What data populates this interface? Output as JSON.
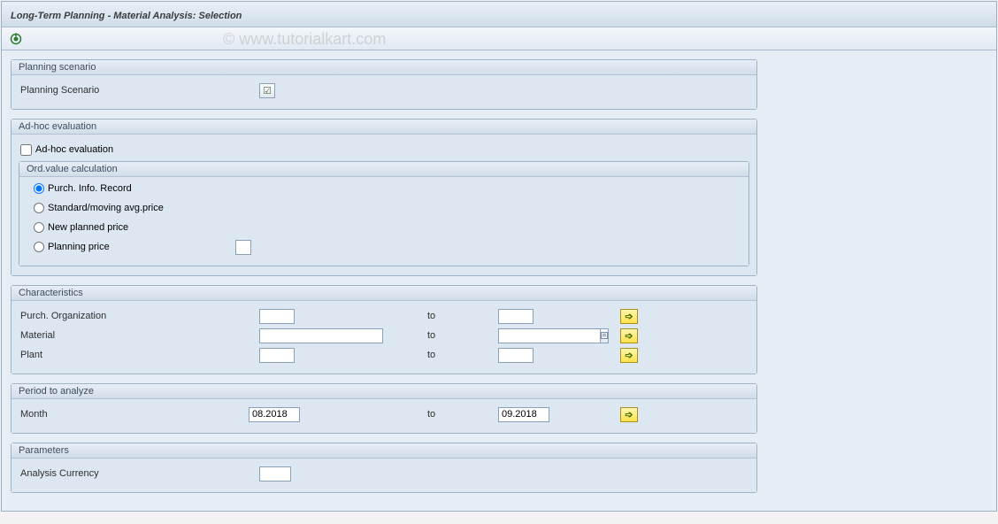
{
  "window": {
    "title": "Long-Term Planning - Material Analysis: Selection"
  },
  "watermark": "© www.tutorialkart.com",
  "icons": {
    "execute": "execute-icon",
    "arrow": "➩",
    "valuehelp": "☑"
  },
  "groups": {
    "planning_scenario": {
      "title": "Planning scenario",
      "field_label": "Planning Scenario",
      "value": ""
    },
    "adhoc": {
      "title": "Ad-hoc evaluation",
      "checkbox_label": "Ad-hoc evaluation",
      "checked": false,
      "subgroup_title": "Ord.value calculation",
      "options": [
        {
          "label": "Purch. Info. Record",
          "selected": true
        },
        {
          "label": "Standard/moving avg.price",
          "selected": false
        },
        {
          "label": "New planned price",
          "selected": false
        },
        {
          "label": "Planning price",
          "selected": false,
          "has_input": true,
          "value": ""
        }
      ]
    },
    "characteristics": {
      "title": "Characteristics",
      "to_label": "to",
      "rows": [
        {
          "label": "Purch. Organization",
          "from": "",
          "to": "",
          "size": "xs"
        },
        {
          "label": "Material",
          "from": "",
          "to": "",
          "size": "md"
        },
        {
          "label": "Plant",
          "from": "",
          "to": "",
          "size": "xs"
        }
      ]
    },
    "period": {
      "title": "Period to analyze",
      "to_label": "to",
      "label": "Month",
      "from": "08.2018",
      "to": "09.2018"
    },
    "parameters": {
      "title": "Parameters",
      "field_label": "Analysis Currency",
      "value": ""
    }
  }
}
